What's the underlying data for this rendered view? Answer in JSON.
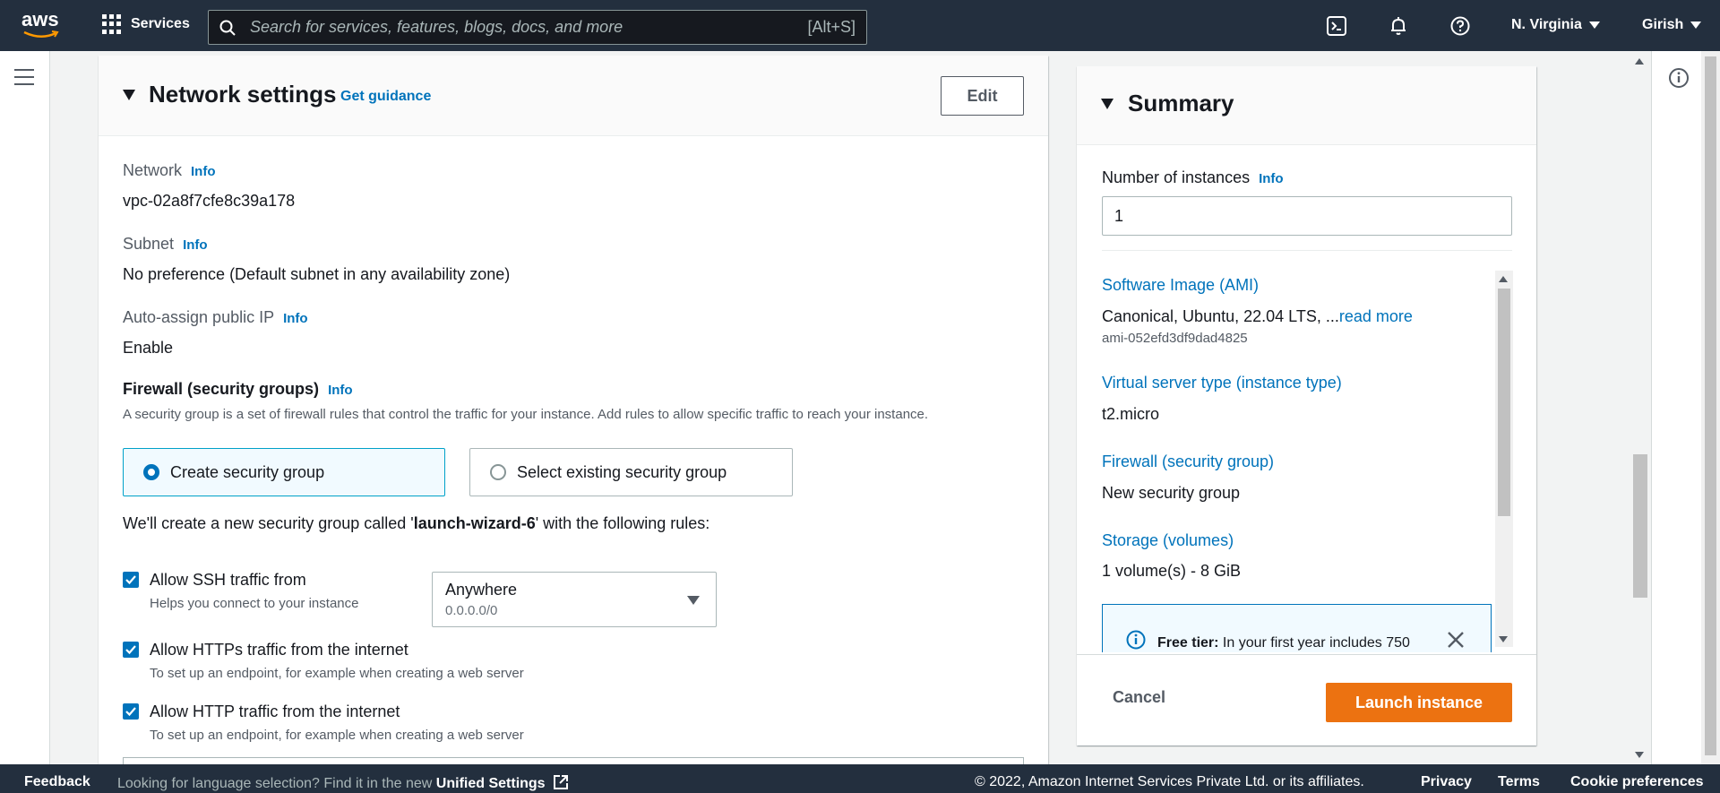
{
  "topnav": {
    "logo_text": "aws",
    "services_label": "Services",
    "search_placeholder": "Search for services, features, blogs, docs, and more",
    "search_shortcut": "[Alt+S]",
    "region": "N. Virginia",
    "user": "Girish",
    "icons": [
      "cloudshell-icon",
      "bell-icon",
      "help-icon"
    ]
  },
  "network": {
    "title": "Network settings",
    "guidance": "Get guidance",
    "edit_label": "Edit",
    "info_label": "Info",
    "network_label": "Network",
    "network_value": "vpc-02a8f7cfe8c39a178",
    "subnet_label": "Subnet",
    "subnet_value": "No preference (Default subnet in any availability zone)",
    "public_ip_label": "Auto-assign public IP",
    "public_ip_value": "Enable",
    "firewall_label": "Firewall (security groups)",
    "firewall_desc": "A security group is a set of firewall rules that control the traffic for your instance. Add rules to allow specific traffic to reach your instance.",
    "option_create": "Create security group",
    "option_select": "Select existing security group",
    "rules_prefix": "We'll create a new security group called '",
    "rules_name": "launch-wizard-6",
    "rules_suffix": "' with the following rules:",
    "ssh_label": "Allow SSH traffic from",
    "ssh_help": "Helps you connect to your instance",
    "ssh_source": "Anywhere",
    "ssh_cidr": "0.0.0.0/0",
    "https_label": "Allow HTTPs traffic from the internet",
    "https_help": "To set up an endpoint, for example when creating a web server",
    "http_label": "Allow HTTP traffic from the internet",
    "http_help": "To set up an endpoint, for example when creating a web server"
  },
  "summary": {
    "title": "Summary",
    "instances_label": "Number of instances",
    "info_label": "Info",
    "instances_value": "1",
    "ami_label": "Software Image (AMI)",
    "ami_value": "Canonical, Ubuntu, 22.04 LTS, ...",
    "ami_read_more": "read more",
    "ami_id": "ami-052efd3df9dad4825",
    "type_label": "Virtual server type (instance type)",
    "type_value": "t2.micro",
    "firewall_label": "Firewall (security group)",
    "firewall_value": "New security group",
    "storage_label": "Storage (volumes)",
    "storage_value": "1 volume(s) - 8 GiB",
    "free_tier_bold": "Free tier:",
    "free_tier_text": " In your first year includes 750",
    "cancel_label": "Cancel",
    "launch_label": "Launch instance"
  },
  "footer": {
    "feedback": "Feedback",
    "lang_text": "Looking for language selection? Find it in the new ",
    "lang_link": "Unified Settings",
    "copyright": "© 2022, Amazon Internet Services Private Ltd. or its affiliates.",
    "privacy": "Privacy",
    "terms": "Terms",
    "cookies": "Cookie preferences"
  },
  "colors": {
    "nav_bg": "#232f3e",
    "link": "#0073bb",
    "primary_button": "#ec7211"
  }
}
